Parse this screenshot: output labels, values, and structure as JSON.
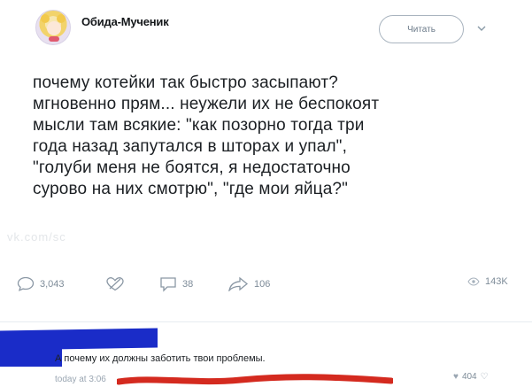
{
  "profile": {
    "display_name": "Обида-Мученик",
    "avatar_icon": "anime-avatar-icon"
  },
  "header": {
    "follow_label": "Читать",
    "menu_icon": "chevron-down-icon"
  },
  "tweet": {
    "lines": [
      "почему котейки так быстро засыпают?",
      "мгновенно прям... неужели их не беспокоят",
      "мысли там всякие: \"как позорно тогда три",
      "года назад запутался в шторах и упал\",",
      "\"голуби меня не боятся, я недостаточно",
      "сурово на них смотрю\", \"где мои яйца?\""
    ],
    "watermark": "vk.com/sc"
  },
  "actions": {
    "reply_count": "3,043",
    "comment_count": "38",
    "share_count": "106",
    "views_count": "143K"
  },
  "comment": {
    "text": "А почему их должны заботить твои проблемы.",
    "date": "today at 3:06",
    "likes": "404"
  },
  "colors": {
    "redaction": "#1a2cc8",
    "scribble": "#d42a1f",
    "muted": "#7e8c99"
  }
}
